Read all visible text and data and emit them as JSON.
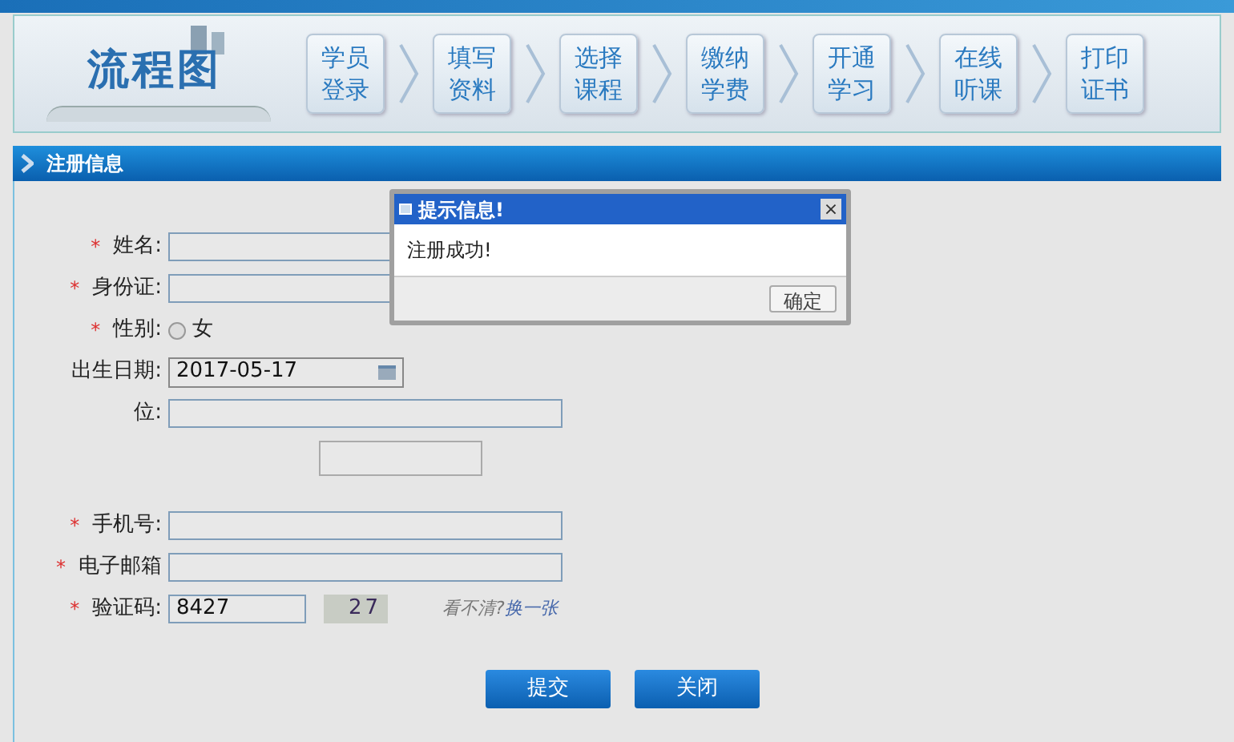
{
  "banner": {
    "logo_text": "流程图",
    "steps": [
      {
        "lines": [
          "学员",
          "登录"
        ]
      },
      {
        "lines": [
          "填写",
          "资料"
        ]
      },
      {
        "lines": [
          "选择",
          "课程"
        ]
      },
      {
        "lines": [
          "缴纳",
          "学费"
        ]
      },
      {
        "lines": [
          "开通",
          "学习"
        ]
      },
      {
        "lines": [
          "在线",
          "听课"
        ]
      },
      {
        "lines": [
          "打印",
          "证书"
        ]
      }
    ]
  },
  "section_title": "注册信息",
  "form": {
    "rows": [
      {
        "kind": "short_text",
        "mark": "*",
        "label": "姓名:"
      },
      {
        "kind": "short_text",
        "mark": "*",
        "label": "身份证:"
      },
      {
        "kind": "radio",
        "mark": "*",
        "label": "性别:",
        "options": [
          {
            "label": "女",
            "selected": false
          }
        ]
      },
      {
        "kind": "date",
        "label": "出生日期:",
        "value": "2017-05-17"
      },
      {
        "kind": "text",
        "label": "位:"
      },
      {
        "kind": "blank"
      },
      {
        "kind": "text",
        "mark": "*",
        "label": "手机号:"
      },
      {
        "kind": "text",
        "mark": "*",
        "label": "电子邮箱"
      },
      {
        "kind": "captcha",
        "mark": "*",
        "label": "验证码:",
        "value": "8427",
        "image_text": "27",
        "hint": "看不清?",
        "link": "换一张"
      }
    ],
    "buttons": [
      "提交",
      "关闭"
    ]
  },
  "dialog": {
    "title": "提示信息!",
    "close": "×",
    "message": "注册成功!",
    "button": "确定"
  }
}
